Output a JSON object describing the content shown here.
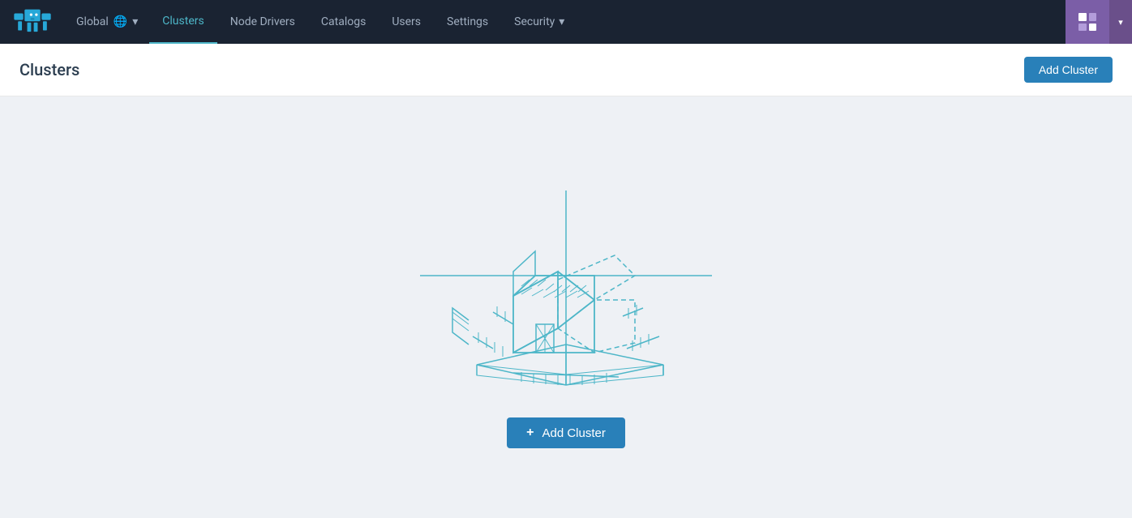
{
  "navbar": {
    "brand": "Rancher",
    "global_label": "Global",
    "nav_items": [
      {
        "id": "clusters",
        "label": "Clusters",
        "active": true
      },
      {
        "id": "node-drivers",
        "label": "Node Drivers",
        "active": false
      },
      {
        "id": "catalogs",
        "label": "Catalogs",
        "active": false
      },
      {
        "id": "users",
        "label": "Users",
        "active": false
      },
      {
        "id": "settings",
        "label": "Settings",
        "active": false
      },
      {
        "id": "security",
        "label": "Security",
        "active": false,
        "has_dropdown": true
      }
    ]
  },
  "page": {
    "title": "Clusters",
    "add_cluster_label": "Add Cluster"
  },
  "empty_state": {
    "add_cluster_label": "Add Cluster",
    "plus_symbol": "+"
  },
  "icons": {
    "globe": "🌐",
    "chevron_down": "▾"
  }
}
